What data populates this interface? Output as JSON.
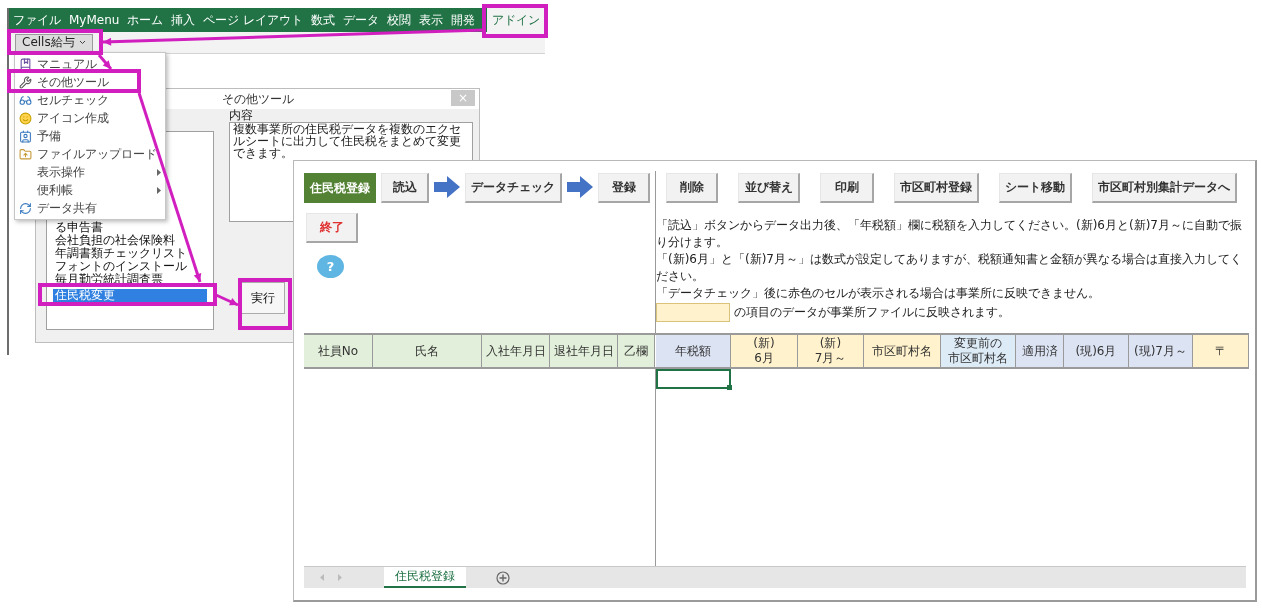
{
  "ribbon": {
    "tabs": [
      {
        "label": "ファイル",
        "selected": false
      },
      {
        "label": "MyMenu",
        "selected": false
      },
      {
        "label": "ホーム",
        "selected": false
      },
      {
        "label": "挿入",
        "selected": false
      },
      {
        "label": "ページ レイアウト",
        "selected": false
      },
      {
        "label": "数式",
        "selected": false
      },
      {
        "label": "データ",
        "selected": false
      },
      {
        "label": "校閲",
        "selected": false
      },
      {
        "label": "表示",
        "selected": false
      },
      {
        "label": "開発",
        "selected": false
      },
      {
        "label": "アドイン",
        "selected": true
      }
    ],
    "addin_button": "Cells給与"
  },
  "addin_menu": {
    "items": [
      {
        "label": "マニュアル",
        "has_submenu": false
      },
      {
        "label": "その他ツール",
        "has_submenu": false
      },
      {
        "label": "セルチェック",
        "has_submenu": false
      },
      {
        "label": "アイコン作成",
        "has_submenu": false
      },
      {
        "label": "予備",
        "has_submenu": false
      },
      {
        "label": "ファイルアップロード",
        "has_submenu": false
      },
      {
        "label": "表示操作",
        "has_submenu": true
      },
      {
        "label": "便利帳",
        "has_submenu": true
      },
      {
        "label": "データ共有",
        "has_submenu": false
      }
    ]
  },
  "dialog": {
    "title": "その他ツール",
    "close": "×",
    "list": [
      {
        "label": "る申告書",
        "selected": false
      },
      {
        "label": "会社負担の社会保険料",
        "selected": false
      },
      {
        "label": "年調書類チェックリスト",
        "selected": false
      },
      {
        "label": "フォントのインストール",
        "selected": false
      },
      {
        "label": "毎月勤労統計調査票",
        "selected": false
      },
      {
        "label": "住民税変更",
        "selected": true
      }
    ],
    "content_label": "内容",
    "content_text": "複数事業所の住民税データを複数のエクセルシートに出力して住民税をまとめて変更できます。",
    "run_button": "実行"
  },
  "sheet": {
    "title": "住民税登録",
    "flow_buttons": [
      "読込",
      "データチェック",
      "登録"
    ],
    "action_buttons": [
      "削除",
      "並び替え",
      "印刷",
      "市区町村登録",
      "シート移動",
      "市区町村別集計データへ"
    ],
    "exit_button": "終了",
    "help": "?",
    "instructions": [
      "「読込」ボタンからデータ出力後、「年税額」欄に税額を入力してください。(新)6月と(新)7月～に自動で振り分けます。",
      "「(新)6月」と「(新)7月～」は数式が設定してありますが、税額通知書と金額が異なる場合は直接入力してください。",
      "「データチェック」後に赤色のセルが表示される場合は事業所に反映できません。"
    ],
    "legend_text": "の項目のデータが事業所ファイルに反映されます。",
    "left_columns": [
      {
        "lines": [
          "社員No"
        ],
        "color": "#e2efda"
      },
      {
        "lines": [
          "氏名"
        ],
        "color": "#e2efda"
      },
      {
        "lines": [
          "入社年月日"
        ],
        "color": "#e2efda"
      },
      {
        "lines": [
          "退社年月日"
        ],
        "color": "#e2efda"
      },
      {
        "lines": [
          "乙欄"
        ],
        "color": "#e2efda"
      }
    ],
    "right_columns": [
      {
        "lines": [
          "年税額"
        ],
        "color": "#dce3f3"
      },
      {
        "lines": [
          "(新)",
          "6月"
        ],
        "color": "#fff2cc"
      },
      {
        "lines": [
          "(新)",
          "7月～"
        ],
        "color": "#fff2cc"
      },
      {
        "lines": [
          "市区町村名"
        ],
        "color": "#fff2cc"
      },
      {
        "lines": [
          "変更前の",
          "市区町村名"
        ],
        "color": "#ddebf7"
      },
      {
        "lines": [
          "適用済"
        ],
        "color": "#dce3f3"
      },
      {
        "lines": [
          "(現)6月"
        ],
        "color": "#dce3f3"
      },
      {
        "lines": [
          "(現)7月～"
        ],
        "color": "#dce3f3"
      },
      {
        "lines": [
          "〒"
        ],
        "color": "#fff2cc"
      }
    ],
    "sheet_tabs": [
      {
        "label": "住民税登録",
        "selected": true
      }
    ]
  }
}
